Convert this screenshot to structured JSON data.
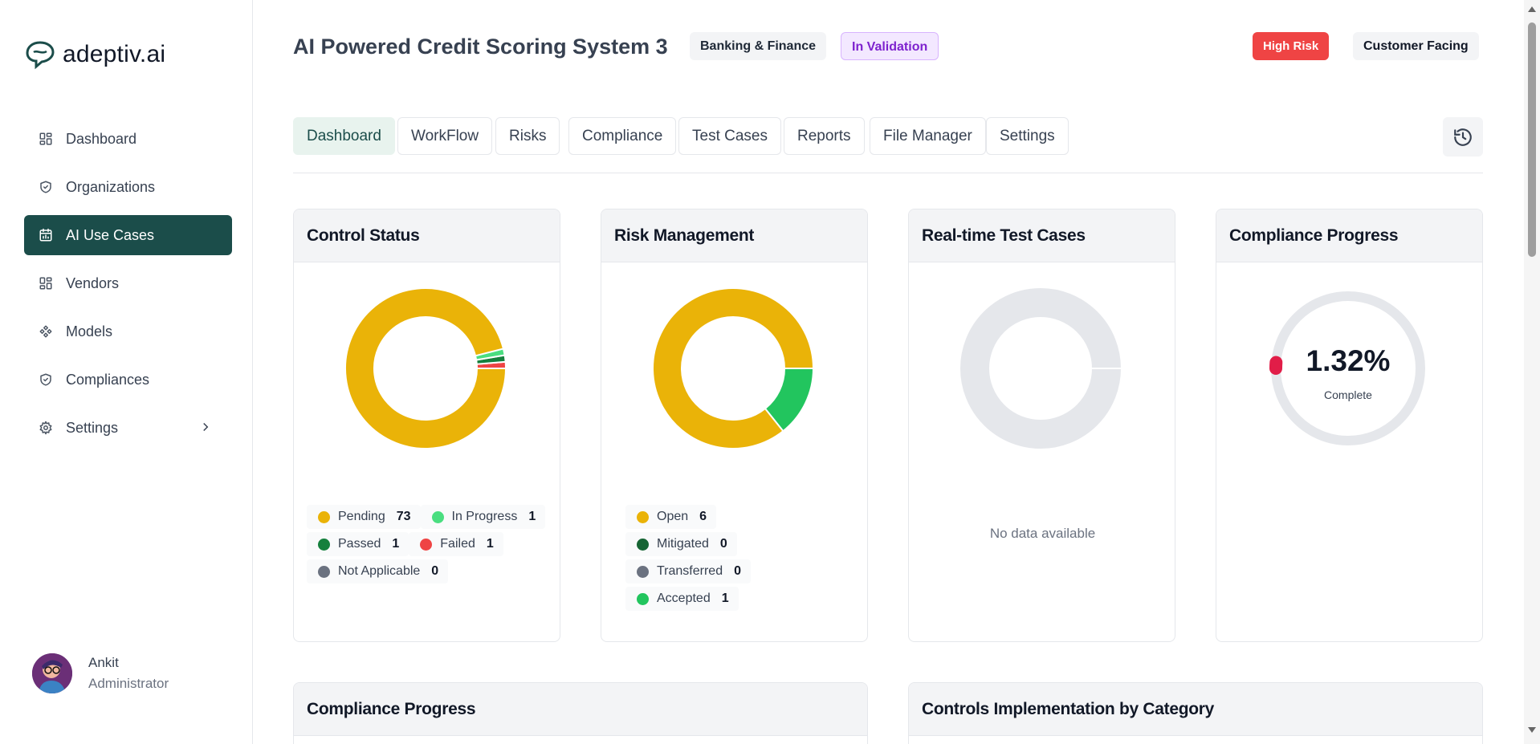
{
  "app": {
    "brand": "adeptiv.ai"
  },
  "sidebar": {
    "items": [
      {
        "label": "Dashboard",
        "icon": "grid-icon"
      },
      {
        "label": "Organizations",
        "icon": "shield-check-icon"
      },
      {
        "label": "AI Use Cases",
        "icon": "calendar-chart-icon",
        "active": true
      },
      {
        "label": "Vendors",
        "icon": "grid-icon"
      },
      {
        "label": "Models",
        "icon": "nodes-icon"
      },
      {
        "label": "Compliances",
        "icon": "shield-check-icon"
      },
      {
        "label": "Settings",
        "icon": "gear-icon",
        "expandable": true
      }
    ]
  },
  "user": {
    "name": "Ankit",
    "role": "Administrator"
  },
  "header": {
    "title": "AI Powered Credit Scoring System 3",
    "domain_tag": "Banking & Finance",
    "status_tag": "In Validation",
    "risk_tag": "High Risk",
    "facing_tag": "Customer Facing"
  },
  "tabs": [
    "Dashboard",
    "WorkFlow",
    "Risks",
    "Compliance",
    "Test Cases",
    "Reports",
    "File Manager",
    "Settings"
  ],
  "active_tab": "Dashboard",
  "colors": {
    "primary": "#1b4d4a",
    "pending": "#eab308",
    "in_progress": "#4ade80",
    "passed": "#15803d",
    "failed": "#ef4444",
    "na": "#6b7280",
    "accepted": "#22c55e",
    "mitigated": "#166534",
    "empty": "#e5e7eb",
    "compliance_marker": "#e11d48"
  },
  "cards": {
    "control_status": {
      "title": "Control Status",
      "legend": [
        {
          "label": "Pending",
          "count": "73"
        },
        {
          "label": "In Progress",
          "count": "1"
        },
        {
          "label": "Passed",
          "count": "1"
        },
        {
          "label": "Failed",
          "count": "1"
        },
        {
          "label": "Not Applicable",
          "count": "0"
        }
      ]
    },
    "risk_management": {
      "title": "Risk Management",
      "legend": [
        {
          "label": "Open",
          "count": "6"
        },
        {
          "label": "Mitigated",
          "count": "0"
        },
        {
          "label": "Transferred",
          "count": "0"
        },
        {
          "label": "Accepted",
          "count": "1"
        }
      ]
    },
    "test_cases": {
      "title": "Real-time Test Cases",
      "empty": "No data available"
    },
    "compliance": {
      "title": "Compliance Progress",
      "value": "1.32%",
      "sub": "Complete"
    }
  },
  "bottom": {
    "left_title": "Compliance Progress",
    "right_title": "Controls Implementation by Category"
  },
  "chart_data": [
    {
      "type": "pie",
      "title": "Control Status",
      "categories": [
        "Pending",
        "In Progress",
        "Passed",
        "Failed",
        "Not Applicable"
      ],
      "values": [
        73,
        1,
        1,
        1,
        0
      ]
    },
    {
      "type": "pie",
      "title": "Risk Management",
      "categories": [
        "Open",
        "Mitigated",
        "Transferred",
        "Accepted"
      ],
      "values": [
        6,
        0,
        0,
        1
      ]
    },
    {
      "type": "pie",
      "title": "Compliance Progress",
      "categories": [
        "Complete"
      ],
      "values": [
        1.32
      ]
    }
  ]
}
